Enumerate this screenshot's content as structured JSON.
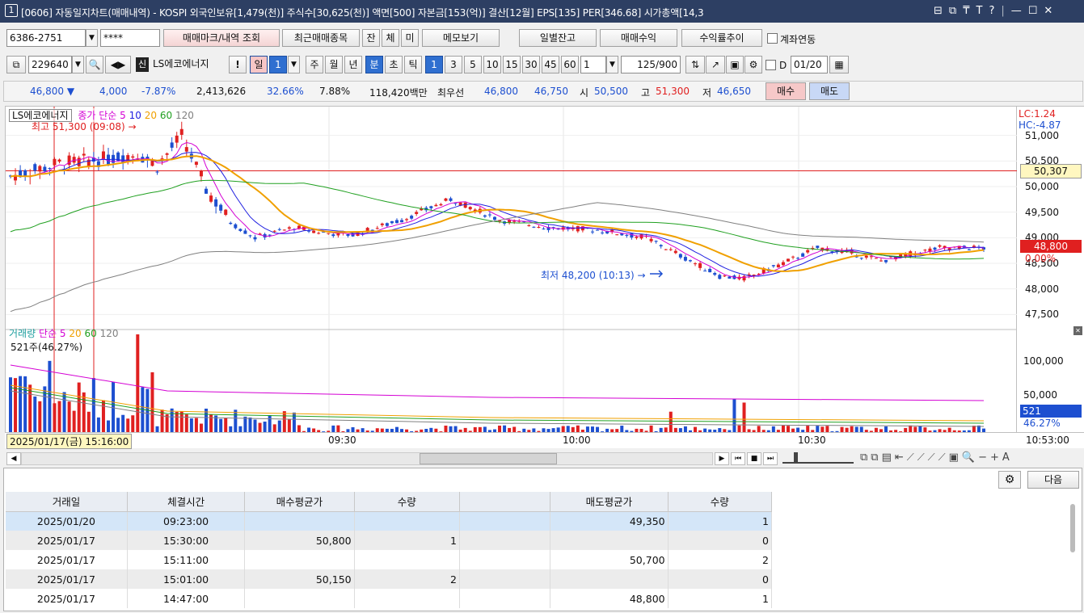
{
  "window": {
    "number": "1",
    "title": "[0606] 자동일지차트(매매내역) - KOSPI 외국인보유[1,479(천)] 주식수[30,625(천)] 액면[500] 자본금[153(억)] 결산[12월] EPS[135] PER[346.68] 시가총액[14,3",
    "controls": [
      "⊟",
      "⧉",
      "₸",
      "T",
      "?",
      "|",
      "—",
      "☐",
      "✕"
    ]
  },
  "toolbar1": {
    "account": "6386-2751",
    "password": "****",
    "btn_trade_mark": "매매마크/내역 조회",
    "btn_recent": "최근매매종목",
    "btn_jan": "잔",
    "btn_che": "체",
    "btn_mi": "미",
    "btn_memo": "메모보기",
    "btn_daily_balance": "일별잔고",
    "btn_trade_profit": "매매수익",
    "btn_yield": "수익률추이",
    "link_label": "계좌연동"
  },
  "toolbar2": {
    "code": "229640",
    "name_badge": "신",
    "stock_name": "LS에코에너지",
    "excl": "!",
    "period_day": "일",
    "period_num": "1",
    "period_week": "주",
    "period_month": "월",
    "period_year": "년",
    "period_min": "분",
    "period_sec": "초",
    "period_tick": "틱",
    "intervals": [
      "1",
      "3",
      "5",
      "10",
      "15",
      "30",
      "45",
      "60"
    ],
    "interval_value": "1",
    "count_value": "125",
    "count_total": "/900",
    "d_label": "D",
    "date_value": "01/20"
  },
  "quote": {
    "price": "46,800",
    "change": "4,000",
    "change_pct": "-7.87%",
    "volume": "2,413,626",
    "vol_rate": "32.66%",
    "turnover": "7.88%",
    "amount": "118,420백만",
    "best_label": "최우선",
    "best_ask": "46,800",
    "best_bid": "46,750",
    "open_label": "시",
    "open": "50,500",
    "high_label": "고",
    "high": "51,300",
    "low_label": "저",
    "low": "46,650",
    "buy": "매수",
    "sell": "매도"
  },
  "price_panel": {
    "legend_name": "LS에코에너지",
    "legend_ma": "종가 단순",
    "ma_periods": [
      "5",
      "10",
      "20",
      "60",
      "120"
    ],
    "ma_colors": [
      "#d400d4",
      "#2020e0",
      "#f0a000",
      "#20a020",
      "#808080"
    ],
    "high_annotation": "최고 51,300 (09:08) →",
    "low_annotation": "최저 48,200 (10:13) →",
    "lc": "LC:1.24",
    "hc": "HC:-4.87",
    "y_ticks": [
      "51,000",
      "50,500",
      "50,000",
      "49,500",
      "49,000",
      "48,500",
      "48,000",
      "47,500"
    ],
    "y_ref": [
      51000,
      50500,
      50000,
      49500,
      49000,
      48500,
      48000,
      47500
    ],
    "ref_line_label": "50,307",
    "current_label": "48,800",
    "current_pct": "0.00%"
  },
  "volume_panel": {
    "legend": "거래량",
    "legend_ma": "단순",
    "ma_periods": [
      "5",
      "20",
      "60",
      "120"
    ],
    "last_volume": "521주(46.27%)",
    "y_ticks": [
      "100,000",
      "50,000"
    ],
    "current_label": "521",
    "current_pct": "46.27%"
  },
  "time_axis": {
    "cursor_label": "2025/01/17(금) 15:16:00",
    "labels": [
      "09:30",
      "10:00",
      "10:30"
    ],
    "right_label": "10:53:00"
  },
  "chart_data": {
    "type": "candlestick",
    "title": "",
    "x": [
      "2025/01/17 15:16",
      "09:30",
      "10:00",
      "10:30",
      "10:53"
    ],
    "price_range": [
      47300,
      51500
    ],
    "volume_range": [
      0,
      130000
    ],
    "highlights": {
      "high": 51300,
      "high_time": "09:08",
      "low": 48200,
      "low_time": "10:13",
      "ref_line": 50307,
      "current": 48800
    }
  },
  "panel": {
    "next_label": "다음",
    "columns": [
      "거래일",
      "체결시간",
      "매수평균가",
      "수량",
      "",
      "매도평균가",
      "수량"
    ],
    "rows": [
      [
        "2025/01/20",
        "09:23:00",
        "",
        "",
        "",
        "49,350",
        "1"
      ],
      [
        "2025/01/17",
        "15:30:00",
        "50,800",
        "1",
        "",
        "",
        "0"
      ],
      [
        "2025/01/17",
        "15:11:00",
        "",
        "",
        "",
        "50,700",
        "2"
      ],
      [
        "2025/01/17",
        "15:01:00",
        "50,150",
        "2",
        "",
        "",
        "0"
      ],
      [
        "2025/01/17",
        "14:47:00",
        "",
        "",
        "",
        "48,800",
        "1"
      ]
    ]
  }
}
